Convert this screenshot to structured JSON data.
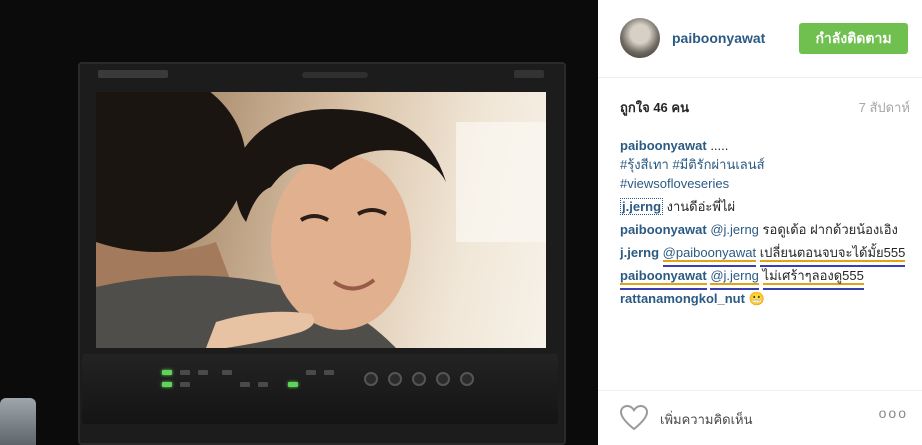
{
  "post": {
    "username": "paiboonyawat",
    "follow_button": "กำลังติดตาม",
    "likes": "ถูกใจ 46 คน",
    "time_ago": "7 สัปดาห์",
    "caption": {
      "username": "paiboonyawat",
      "text": ".....",
      "hashtags": [
        "#รุ้งสีเทา",
        "#มีติรักผ่านเลนส์",
        "#viewsofloveseries"
      ]
    },
    "comments": [
      {
        "username": "j.jerng",
        "mention": "",
        "text": "งานดีอ่ะพี่ไผ่"
      },
      {
        "username": "paiboonyawat",
        "mention": "@j.jerng",
        "text": "รอดูเด้อ ฝากด้วยน้องเอิง"
      },
      {
        "username": "j.jerng",
        "mention": "@paiboonyawat",
        "text": "เปลี่ยนตอนจบจะได้มั้ย555"
      },
      {
        "username": "paiboonyawat",
        "mention": "@j.jerng",
        "text": "ไม่เศร้าๆลองดู555"
      },
      {
        "username": "rattanamongkol_nut",
        "mention": "",
        "text": "😬"
      }
    ],
    "add_comment_placeholder": "เพิ่มความคิดเห็น",
    "more_options": "ooo"
  },
  "colors": {
    "accent": "#70c050",
    "username": "#2b5a83",
    "muted": "#a5a7aa"
  }
}
